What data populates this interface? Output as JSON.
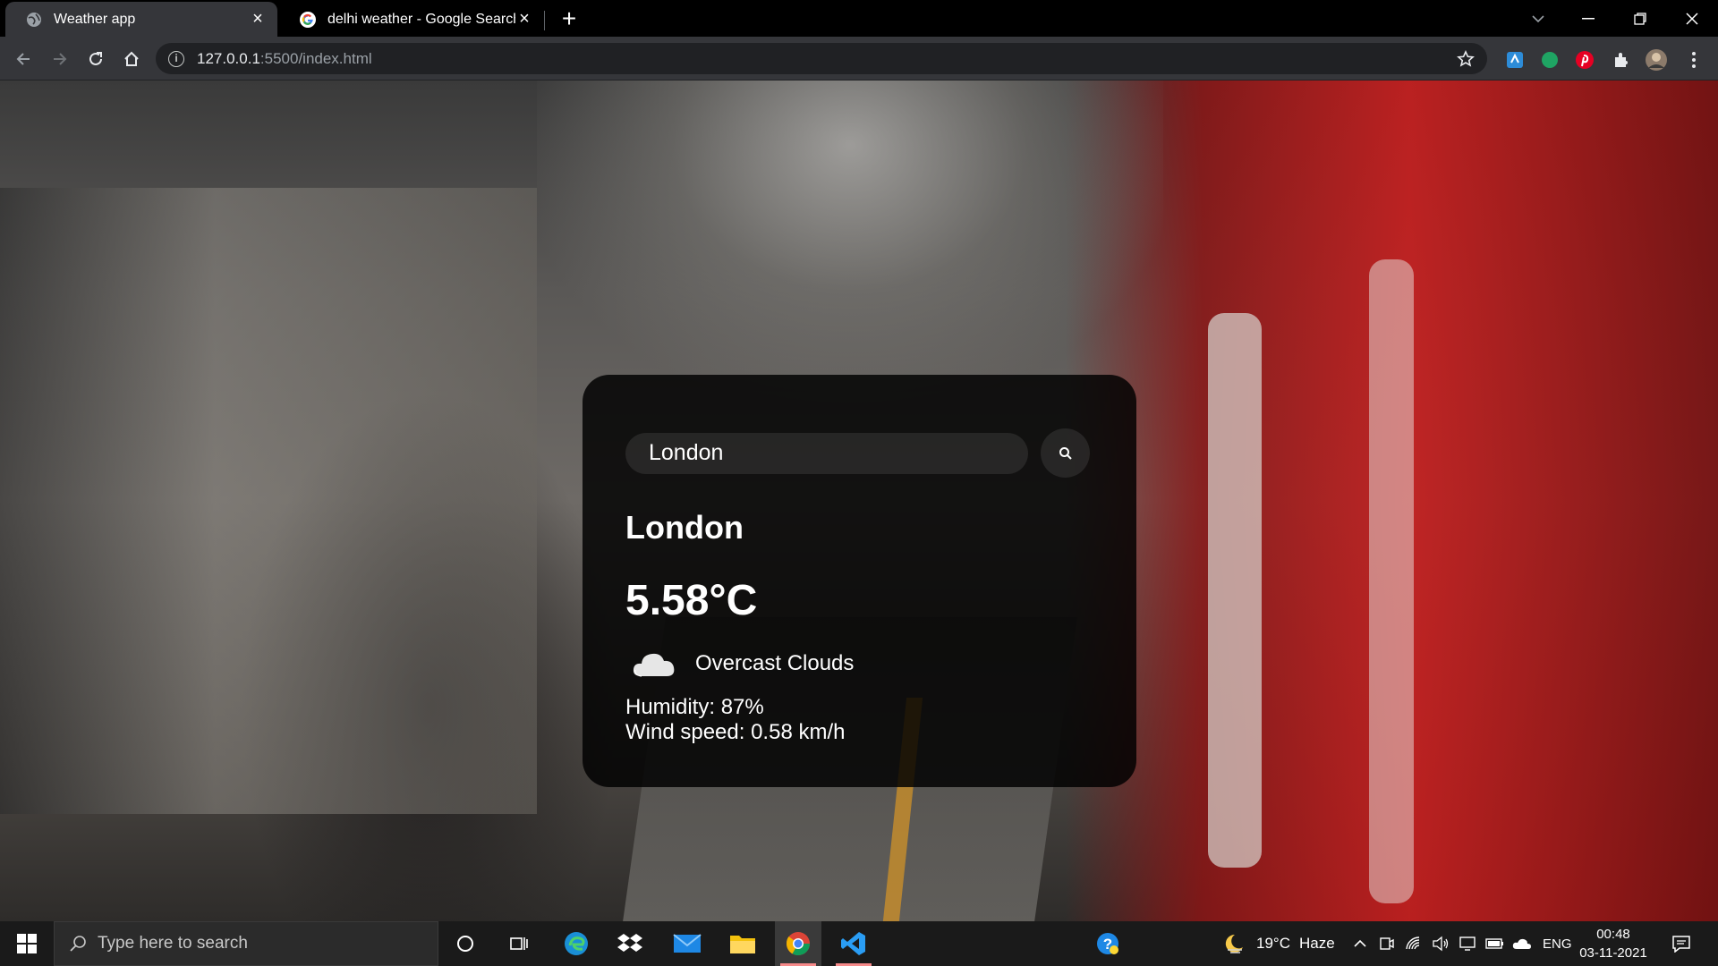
{
  "browser": {
    "tabs": [
      {
        "title": "Weather app",
        "active": true
      },
      {
        "title": "delhi weather - Google Search",
        "active": false
      }
    ],
    "url_host": "127.0.0.1",
    "url_rest": ":5500/index.html"
  },
  "weather": {
    "search_value": "London",
    "city": "London",
    "temperature": "5.58°C",
    "description": "Overcast Clouds",
    "humidity": "Humidity: 87%",
    "wind": "Wind speed: 0.58 km/h",
    "icon": "cloud-icon"
  },
  "taskbar": {
    "search_placeholder": "Type here to search",
    "weather_temp": "19°C",
    "weather_text": "Haze",
    "language": "ENG",
    "time": "00:48",
    "date": "03-11-2021"
  },
  "colors": {
    "card_bg": "#000000d4",
    "accent_red": "#c0392b"
  }
}
